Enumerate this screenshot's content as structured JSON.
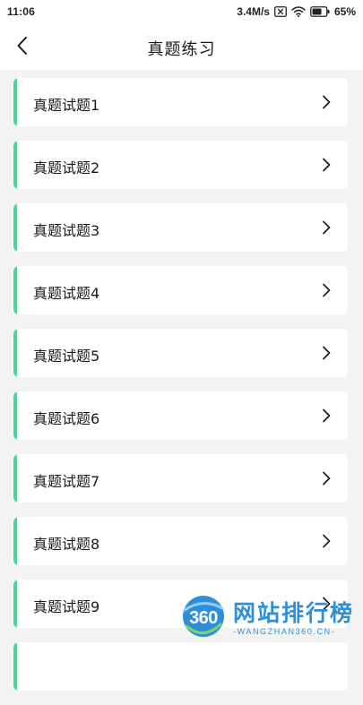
{
  "status_bar": {
    "time": "11:06",
    "network_speed": "3.4M/s",
    "battery_percent": "65%",
    "icons": [
      "sim-off-icon",
      "wifi-icon",
      "battery-icon"
    ]
  },
  "nav": {
    "back_icon": "chevron-left-icon",
    "title": "真题练习"
  },
  "list": {
    "items": [
      {
        "label": "真题试题1"
      },
      {
        "label": "真题试题2"
      },
      {
        "label": "真题试题3"
      },
      {
        "label": "真题试题4"
      },
      {
        "label": "真题试题5"
      },
      {
        "label": "真题试题6"
      },
      {
        "label": "真题试题7"
      },
      {
        "label": "真题试题8"
      },
      {
        "label": "真题试题9"
      },
      {
        "label": ""
      }
    ],
    "item_icon": "chevron-right-icon"
  },
  "watermark": {
    "logo_text": "360",
    "name": "网站排行榜",
    "domain": "-WANGZHAN360.CN-"
  },
  "colors": {
    "accent": "#4cd69b",
    "background": "#f3f3f3",
    "card": "#ffffff",
    "watermark_blue": "#2f8ed8"
  }
}
